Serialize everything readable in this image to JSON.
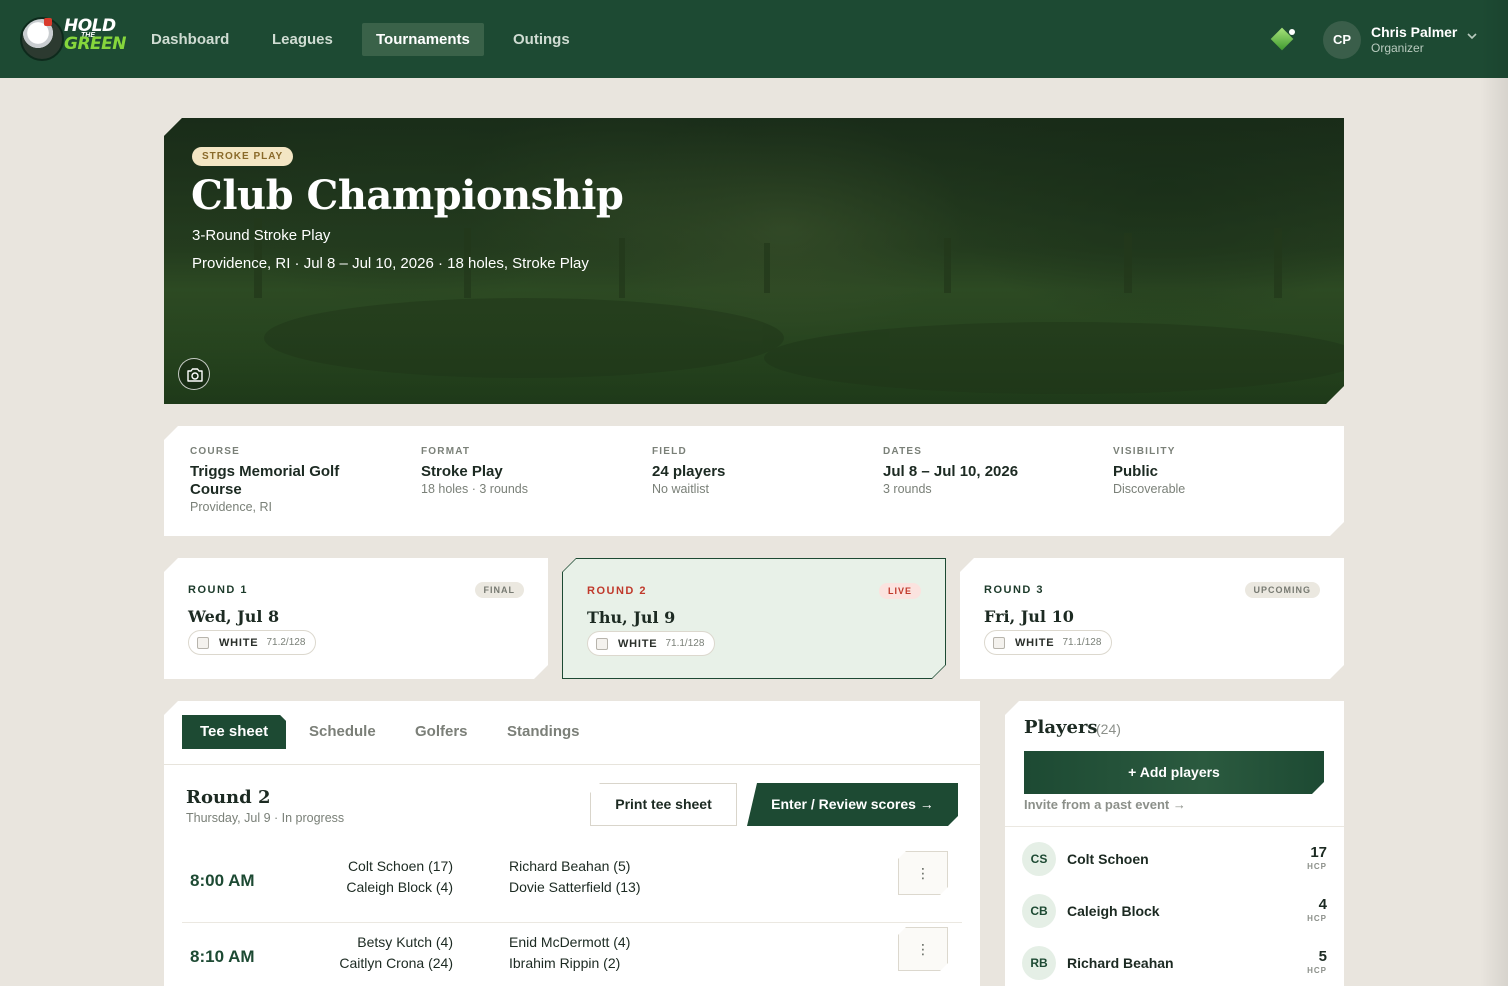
{
  "app": {
    "logo_line1": "HOLD",
    "logo_line2": "THE",
    "logo_line3": "GREEN"
  },
  "nav": {
    "items": [
      {
        "label": "Dashboard",
        "active": false
      },
      {
        "label": "Leagues",
        "active": false
      },
      {
        "label": "Tournaments",
        "active": true
      },
      {
        "label": "Outings",
        "active": false
      }
    ],
    "user": {
      "initials": "CP",
      "name": "Chris Palmer",
      "role": "Organizer"
    },
    "icons": {
      "gem": "gem-icon",
      "chevron": "chevron-down-icon"
    }
  },
  "hero": {
    "badge": "STROKE PLAY",
    "title": "Club Championship",
    "subtitle": "3-Round Stroke Play",
    "meta": "Providence, RI · Jul 8 – Jul 10, 2026 · 18 holes, Stroke Play",
    "camera_icon": "camera-icon"
  },
  "info": [
    {
      "label": "COURSE",
      "value": "Triggs Memorial Golf Course",
      "sub": "Providence, RI"
    },
    {
      "label": "FORMAT",
      "value": "Stroke Play",
      "sub": "18 holes · 3 rounds"
    },
    {
      "label": "FIELD",
      "value": "24 players",
      "sub": "No waitlist"
    },
    {
      "label": "DATES",
      "value": "Jul 8 – Jul 10, 2026",
      "sub": "3 rounds"
    },
    {
      "label": "VISIBILITY",
      "value": "Public",
      "sub": "Discoverable"
    }
  ],
  "rounds": [
    {
      "label": "ROUND 1",
      "date": "Wed, Jul 8",
      "status": "FINAL",
      "tee": "WHITE",
      "rating": "71.2/128"
    },
    {
      "label": "ROUND 2",
      "date": "Thu, Jul 9",
      "status": "LIVE",
      "tee": "WHITE",
      "rating": "71.1/128"
    },
    {
      "label": "ROUND 3",
      "date": "Fri, Jul 10",
      "status": "UPCOMING",
      "tee": "WHITE",
      "rating": "71.1/128"
    }
  ],
  "tabs": [
    "Tee sheet",
    "Schedule",
    "Golfers",
    "Standings"
  ],
  "tee_sheet": {
    "title": "Round 2",
    "subtitle": "Thursday, Jul 9 · In progress",
    "print_label": "Print tee sheet",
    "enter_label": "Enter / Review scores →",
    "more_label": "⋮",
    "rows": [
      {
        "time": "8:00 AM",
        "left": [
          "Colt Schoen (17)",
          "Caleigh Block (4)"
        ],
        "right": [
          "Richard Beahan (5)",
          "Dovie Satterfield (13)"
        ]
      },
      {
        "time": "8:10 AM",
        "left": [
          "Betsy Kutch (4)",
          "Caitlyn Crona (24)"
        ],
        "right": [
          "Enid McDermott (4)",
          "Ibrahim Rippin (2)"
        ]
      }
    ]
  },
  "players": {
    "title": "Players",
    "count": "(24)",
    "add_label": "+ Add players",
    "invite_label": "Invite from a past event →",
    "hcp_label": "HCP",
    "list": [
      {
        "initials": "CS",
        "name": "Colt Schoen",
        "hcp": "17"
      },
      {
        "initials": "CB",
        "name": "Caleigh Block",
        "hcp": "4"
      },
      {
        "initials": "RB",
        "name": "Richard Beahan",
        "hcp": "5"
      }
    ]
  },
  "colors": {
    "brand": "#1d4a33",
    "accent": "#86d63c",
    "live": "#c0392b",
    "background": "#e9e5de"
  }
}
